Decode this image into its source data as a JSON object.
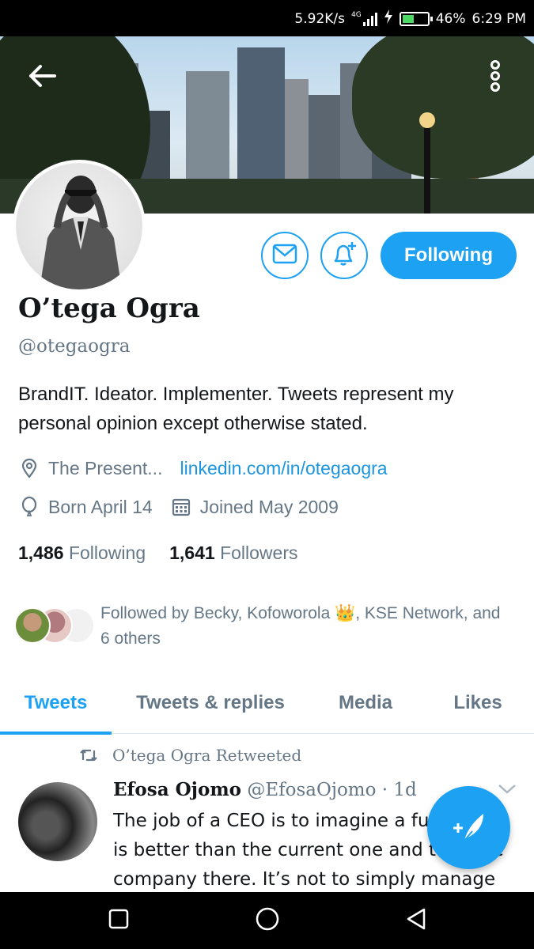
{
  "status_bar": {
    "speed": "5.92K/s",
    "network": "4G",
    "battery_pct_label": "46%",
    "battery_level": 0.46,
    "time": "6:29 PM"
  },
  "profile": {
    "name": "O’tega Ogra",
    "handle": "@otegaogra",
    "bio": "BrandIT. Ideator. Implementer.  Tweets represent my personal opinion except otherwise stated.",
    "location": "The Present...",
    "website": "linkedin.com/in/otegaogra",
    "birthday": "Born April 14",
    "joined": "Joined May 2009",
    "following_count": "1,486",
    "following_label": "Following",
    "followers_count": "1,641",
    "followers_label": "Followers",
    "follow_button_label": "Following",
    "followed_by": "Followed by Becky, Kofoworola 👑, KSE Network, and 6 others"
  },
  "tabs": [
    {
      "label": "Tweets",
      "active": true
    },
    {
      "label": "Tweets & replies",
      "active": false
    },
    {
      "label": "Media",
      "active": false
    },
    {
      "label": "Likes",
      "active": false
    }
  ],
  "tweet": {
    "retweet_label": "O’tega Ogra Retweeted",
    "author": "Efosa Ojomo",
    "author_handle": "@EfosaOjomo",
    "separator": "·",
    "age": "1d",
    "text": "The job of a CEO is to imagine a future that is better than the current one and take the company there. It’s not to simply manage"
  },
  "colors": {
    "accent": "#1da1f2",
    "link": "#1b95e0",
    "secondary_text": "#657786",
    "primary_text": "#14171a"
  },
  "icons": {
    "back": "arrow-left-icon",
    "more": "more-vertical-icon",
    "message": "envelope-icon",
    "notify": "bell-plus-icon",
    "location": "map-pin-icon",
    "birthday": "balloon-icon",
    "joined": "calendar-icon",
    "retweet": "retweet-icon",
    "expand": "chevron-down-icon",
    "compose": "compose-quill-icon"
  }
}
